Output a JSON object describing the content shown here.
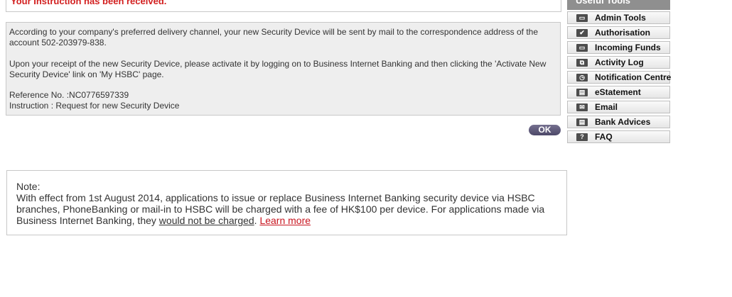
{
  "confirmation": {
    "title": "Your Instruction has been received."
  },
  "details": {
    "paragraph1": "According to your company's preferred delivery channel, your new Security Device will be sent by mail to the correspondence address of the account 502-203979-838.",
    "paragraph2": "Upon your receipt of the new Security Device, please activate it by logging on to Business Internet Banking and then clicking the 'Activate New Security Device' link on 'My HSBC' page.",
    "reference_label": "Reference No. :",
    "reference_value": "NC0776597339",
    "instruction_label": "Instruction : ",
    "instruction_value": "Request for new Security Device"
  },
  "ok_button": {
    "label": "OK"
  },
  "note": {
    "label": "Note:",
    "text_main": "With effect from 1st August 2014, applications to issue or replace Business Internet Banking security device via HSBC branches, PhoneBanking or mail-in to HSBC will be charged with a fee of HK$100 per device. For applications made via Business Internet Banking, they ",
    "text_underlined": "would not be charged",
    "text_period": ". ",
    "learn_more": "Learn more"
  },
  "useful_tools": {
    "header": "Useful Tools",
    "items": [
      {
        "label": "Admin Tools",
        "icon": "admin-tools-icon",
        "glyph": "▭"
      },
      {
        "label": "Authorisation",
        "icon": "authorisation-check-icon",
        "glyph": "✔"
      },
      {
        "label": "Incoming Funds",
        "icon": "incoming-funds-icon",
        "glyph": "▭"
      },
      {
        "label": "Activity Log",
        "icon": "activity-log-icon",
        "glyph": "⧉"
      },
      {
        "label": "Notification Centre",
        "icon": "notification-clock-icon",
        "glyph": "◷"
      },
      {
        "label": "eStatement",
        "icon": "estatement-icon",
        "glyph": "▤"
      },
      {
        "label": "Email",
        "icon": "email-envelope-icon",
        "glyph": "✉"
      },
      {
        "label": "Bank Advices",
        "icon": "bank-advices-icon",
        "glyph": "▤"
      },
      {
        "label": "FAQ",
        "icon": "faq-question-icon",
        "glyph": "?"
      }
    ]
  }
}
